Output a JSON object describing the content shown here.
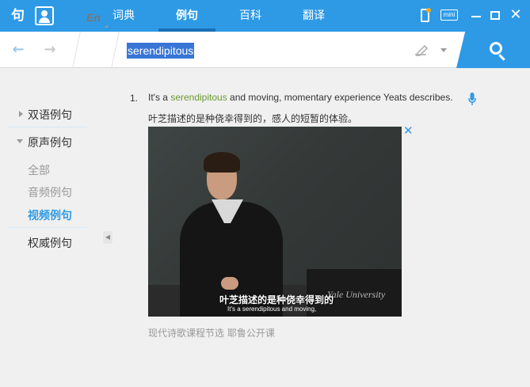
{
  "app": {
    "logo_text": "句",
    "tabs": [
      {
        "label": "词典"
      },
      {
        "label": "例句"
      },
      {
        "label": "百科"
      },
      {
        "label": "翻译"
      }
    ],
    "window_buttons": {
      "mini_label": "mini"
    },
    "accent_color": "#2e9ae6"
  },
  "search": {
    "language": "En",
    "query": "serendipitous"
  },
  "sidebar": {
    "items": [
      {
        "label": "双语例句",
        "expanded": false
      },
      {
        "label": "原声例句",
        "expanded": true
      },
      {
        "label": "权威例句",
        "expanded": false
      }
    ],
    "subitems": [
      {
        "label": "全部"
      },
      {
        "label": "音频例句"
      },
      {
        "label": "视频例句",
        "active": true
      }
    ]
  },
  "example": {
    "number": "1.",
    "en_before": "It's a ",
    "en_highlight": "serendipitous",
    "en_after": " and moving, momentary experience Yeats describes.",
    "cn": "叶芝描述的是种侥幸得到的，感人的短暂的体验。",
    "video": {
      "subtitle_cn": "叶芝描述的是种侥幸得到的",
      "subtitle_en": "It's a serendipitous and moving,",
      "watermark": "Yale University"
    },
    "source": "现代诗歌课程节选 耶鲁公开课"
  }
}
